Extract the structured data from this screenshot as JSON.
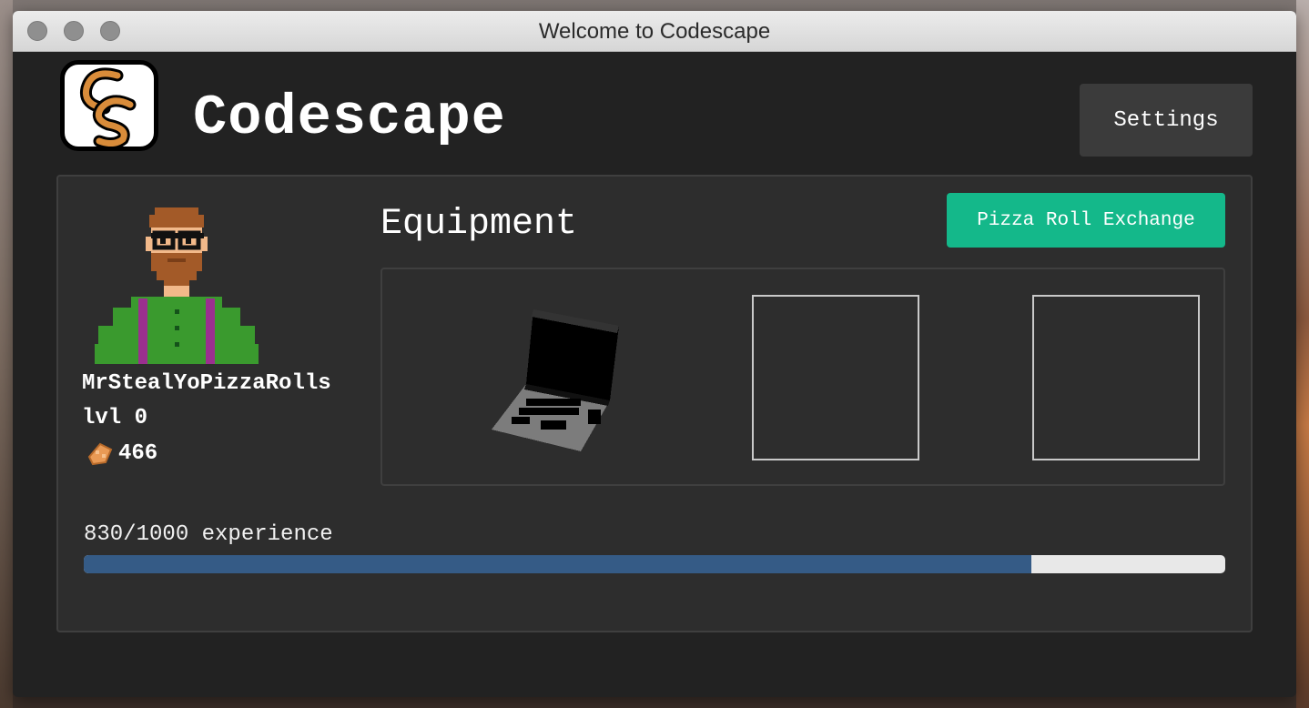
{
  "window": {
    "title": "Welcome to Codescape"
  },
  "header": {
    "app_name": "Codescape",
    "settings_label": "Settings"
  },
  "player": {
    "username": "MrStealYoPizzaRolls",
    "level_text": "lvl 0",
    "pizza_rolls": "466"
  },
  "equipment": {
    "title": "Equipment",
    "exchange_label": "Pizza Roll Exchange",
    "slots": [
      {
        "item": "laptop-icon",
        "filled": true
      },
      {
        "item": null,
        "filled": false
      },
      {
        "item": null,
        "filled": false
      }
    ]
  },
  "experience": {
    "label": "830/1000 experience",
    "current": 830,
    "max": 1000
  },
  "colors": {
    "accent": "#14b88a",
    "progress": "#355b86",
    "background": "#222222",
    "panel": "#2d2d2d"
  }
}
